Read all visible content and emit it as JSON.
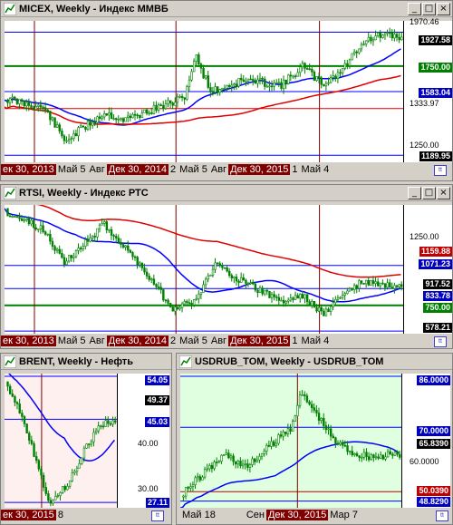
{
  "windows": [
    {
      "key": "micex",
      "title": "MICEX, Weekly - Индекс ММВБ",
      "bg": "#ffffff",
      "scale_labels": [
        "1250.00"
      ],
      "price_tags": [
        "1927.58",
        "1750.00",
        "1583.04",
        "1189.95"
      ],
      "partial_tags": [
        "1970.46",
        "1333.97"
      ],
      "time_axis": [
        "ек 30, 2013",
        "Май 5",
        "Авг",
        "Дек 30, 2014",
        "2",
        "Май 5",
        "Авг",
        "Дек 30, 2015",
        "1",
        "Май 4"
      ]
    },
    {
      "key": "rtsi",
      "title": "RTSI, Weekly - Индекс РТС",
      "bg": "#ffffff",
      "scale_labels": [
        "1250.00"
      ],
      "price_tags": [
        "1159.88",
        "1071.23",
        "917.52",
        "833.78",
        "750.00",
        "578.21"
      ],
      "partial_tags": [],
      "time_axis": [
        "ек 30, 2013",
        "Май 5",
        "Авг",
        "Дек 30, 2014",
        "2",
        "Май 5",
        "Авг",
        "Дек 30, 2015",
        "1",
        "Май 4"
      ]
    },
    {
      "key": "brent",
      "title": "BRENT, Weekly - Нефть",
      "bg": "#fff0f0",
      "scale_labels": [
        "40.00",
        "30.00"
      ],
      "price_tags": [
        "54.05",
        "49.37",
        "45.03",
        "27.11"
      ],
      "partial_tags": [],
      "time_axis": [
        "ек 30, 2015",
        "8"
      ]
    },
    {
      "key": "usdrub",
      "title": "USDRUB_TOM, Weekly - USDRUB_TOM",
      "bg": "#e0ffe0",
      "scale_labels": [
        "60.0000"
      ],
      "price_tags": [
        "86.0000",
        "70.0000",
        "65.8390",
        "50.0390",
        "48.8290"
      ],
      "partial_tags": [],
      "time_axis": [
        "Май 18",
        "Сен",
        "Дек 30, 2015",
        "Мар 7"
      ]
    }
  ],
  "window_buttons": {
    "minimize": "_",
    "maximize": "□",
    "close": "×"
  },
  "corner_label": "tt",
  "colors": {
    "candle": "#008000",
    "ma_fast": "#0000ff",
    "ma_slow": "#e00000",
    "level": "#008000",
    "vline": "#800000"
  }
}
